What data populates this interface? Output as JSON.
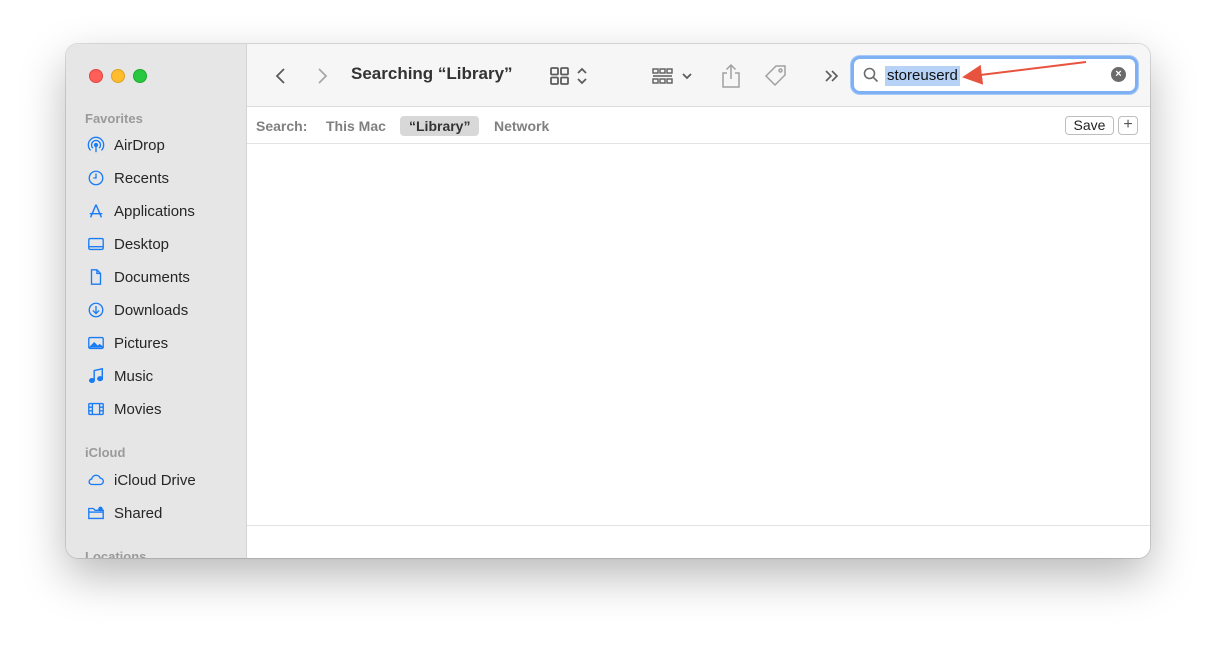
{
  "window": {
    "title": "Searching “Library”"
  },
  "sidebar": {
    "favorites_title": "Favorites",
    "favorites": [
      {
        "label": "AirDrop",
        "icon": "airdrop-icon"
      },
      {
        "label": "Recents",
        "icon": "clock-icon"
      },
      {
        "label": "Applications",
        "icon": "applications-icon"
      },
      {
        "label": "Desktop",
        "icon": "desktop-icon"
      },
      {
        "label": "Documents",
        "icon": "document-icon"
      },
      {
        "label": "Downloads",
        "icon": "download-icon"
      },
      {
        "label": "Pictures",
        "icon": "photo-icon"
      },
      {
        "label": "Music",
        "icon": "music-note-icon"
      },
      {
        "label": "Movies",
        "icon": "film-icon"
      }
    ],
    "icloud_title": "iCloud",
    "icloud": [
      {
        "label": "iCloud Drive",
        "icon": "cloud-icon"
      },
      {
        "label": "Shared",
        "icon": "shared-folder-icon"
      }
    ],
    "locations_title": "Locations"
  },
  "toolbar": {
    "search_value": "storeuserd",
    "icons": [
      "back-chevron-icon",
      "forward-chevron-icon",
      "grid-view-icon",
      "group-by-icon",
      "share-icon",
      "tag-icon",
      "more-chevron-icon",
      "search-icon",
      "clear-icon"
    ]
  },
  "scopebar": {
    "label": "Search:",
    "scopes": [
      "This Mac",
      "“Library”",
      "Network"
    ],
    "active_scope": "“Library”",
    "save_label": "Save",
    "add_label": "+"
  },
  "colors": {
    "accent": "#7eb0f4",
    "selection": "#b6d2f7",
    "sidebar_icon": "#1a7cf5",
    "annotation_arrow": "#e8533f"
  }
}
